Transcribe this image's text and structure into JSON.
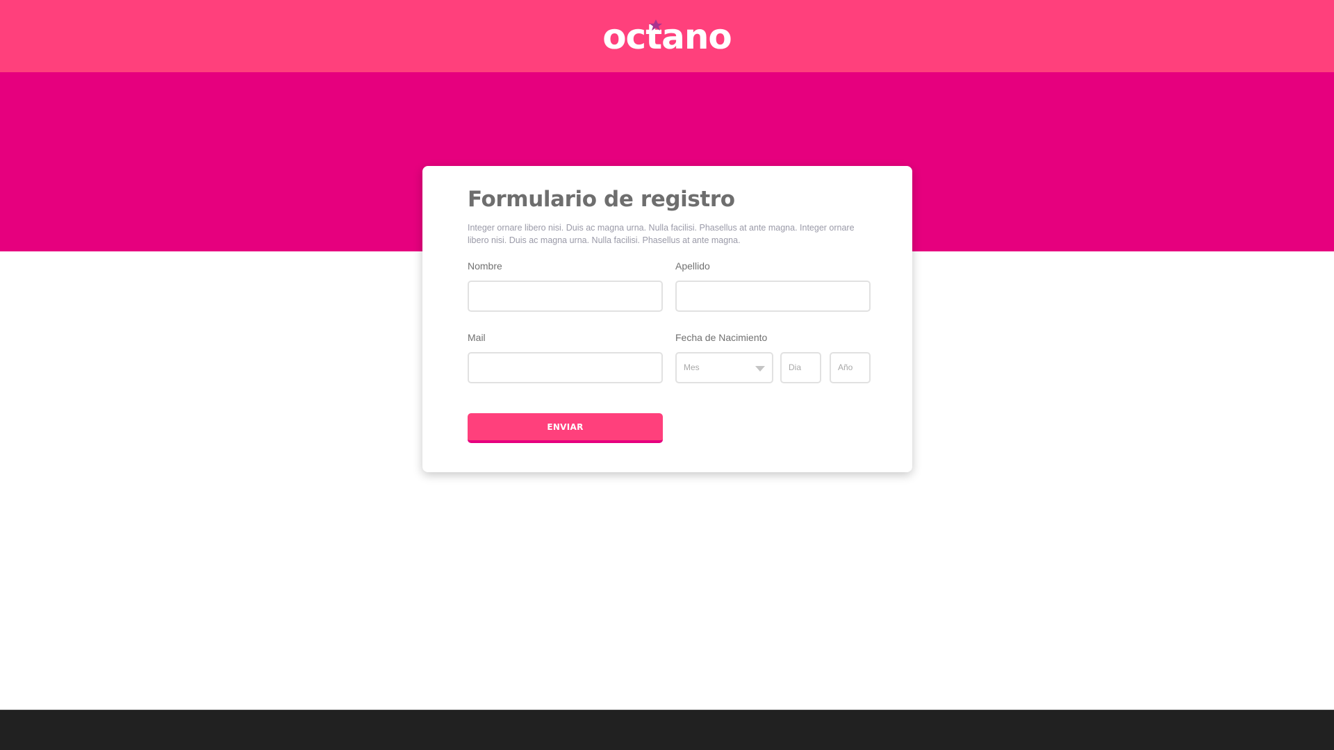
{
  "brand": {
    "logo_text": "octano",
    "colors": {
      "header": "#ff407c",
      "hero": "#e6007e",
      "accent_star": "#a8338f",
      "footer": "#212121"
    }
  },
  "form": {
    "title": "Formulario de registro",
    "description": "Integer ornare libero nisi. Duis ac magna urna. Nulla facilisi. Phasellus at ante magna. Integer ornare libero nisi. Duis ac magna urna. Nulla facilisi. Phasellus at ante magna.",
    "fields": {
      "nombre": {
        "label": "Nombre",
        "value": ""
      },
      "apellido": {
        "label": "Apellido",
        "value": ""
      },
      "mail": {
        "label": "Mail",
        "value": ""
      },
      "fecha": {
        "label": "Fecha de Nacimiento",
        "mes_placeholder": "Mes",
        "dia_placeholder": "Dia",
        "anio_placeholder": "Año"
      }
    },
    "submit_label": "ENVIAR"
  }
}
